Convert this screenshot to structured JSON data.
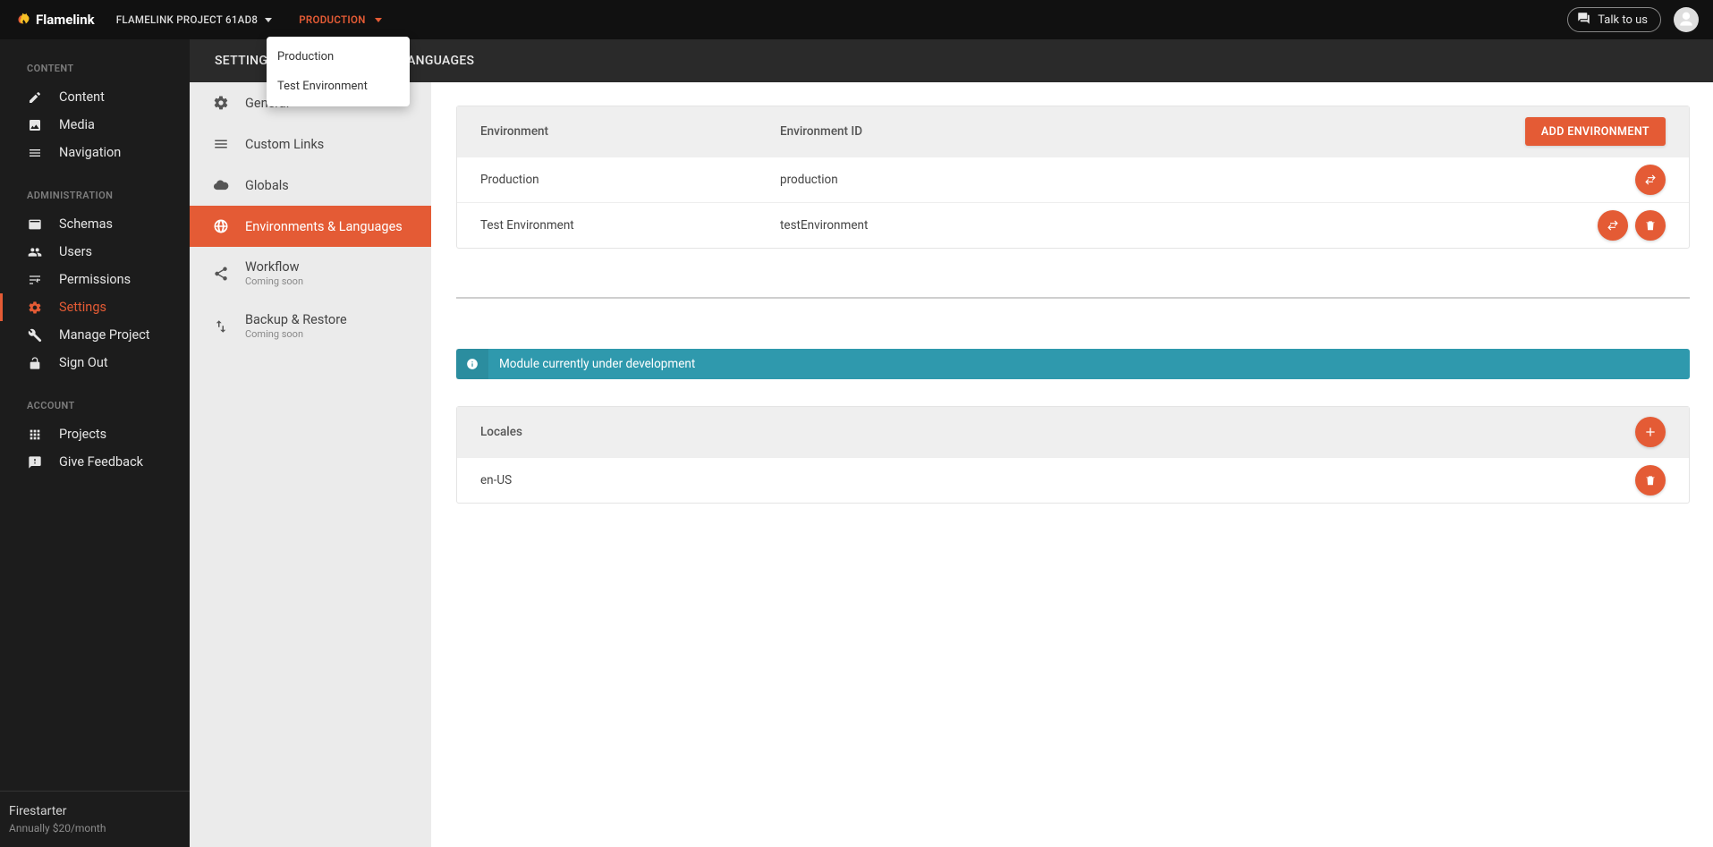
{
  "header": {
    "brand": "Flamelink",
    "project": "FLAMELINK PROJECT 61AD8",
    "env": "PRODUCTION",
    "talk": "Talk to us"
  },
  "env_dropdown": {
    "items": [
      "Production",
      "Test Environment"
    ]
  },
  "sidebar": {
    "sections": [
      {
        "title": "CONTENT",
        "items": [
          "Content",
          "Media",
          "Navigation"
        ]
      },
      {
        "title": "ADMINISTRATION",
        "items": [
          "Schemas",
          "Users",
          "Permissions",
          "Settings",
          "Manage Project",
          "Sign Out"
        ]
      },
      {
        "title": "ACCOUNT",
        "items": [
          "Projects",
          "Give Feedback"
        ]
      }
    ],
    "footer": {
      "plan": "Firestarter",
      "price": "Annually $20/month"
    }
  },
  "subbar": {
    "breadcrumb": "SETTINGS - ENVIRONMENTS & LANGUAGES"
  },
  "settings_nav": {
    "items": [
      {
        "label": "General"
      },
      {
        "label": "Custom Links"
      },
      {
        "label": "Globals"
      },
      {
        "label": "Environments & Languages",
        "active": true
      },
      {
        "label": "Workflow",
        "sub": "Coming soon"
      },
      {
        "label": "Backup & Restore",
        "sub": "Coming soon"
      }
    ]
  },
  "environments": {
    "columns": {
      "name": "Environment",
      "id": "Environment ID"
    },
    "add_btn": "ADD ENVIRONMENT",
    "rows": [
      {
        "name": "Production",
        "id": "production",
        "deletable": false
      },
      {
        "name": "Test Environment",
        "id": "testEnvironment",
        "deletable": true
      }
    ]
  },
  "info": {
    "text": "Module currently under development"
  },
  "locales": {
    "title": "Locales",
    "rows": [
      "en-US"
    ]
  }
}
